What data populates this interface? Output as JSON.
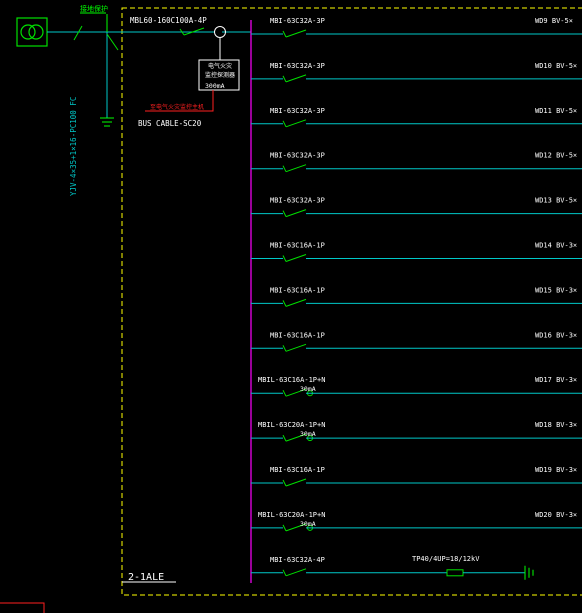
{
  "colors": {
    "background": "#000000",
    "bus": "#ff00ff",
    "feeder": "#00c8c8",
    "breaker": "#00e000",
    "enclosure": "#ffff00",
    "label": "#ffffff",
    "fire_monitor": "#ff2020",
    "grounding": "#00ff00"
  },
  "incoming": {
    "transformer_icon": "transformer-icon",
    "tag_top": "接地保护",
    "cable": "YJV-4×35+1×16-PC100 FC",
    "main_breaker": "MBL60-160C100A-4P",
    "fire_monitor_box": [
      "电气火灾",
      "监控探测器",
      "300mA"
    ],
    "fire_monitor_note": "至电气火灾监控主机",
    "bus_cable": "BUS CABLE-SC20"
  },
  "panel_name": "2-1ALE",
  "circuits": [
    {
      "breaker": "MBI-63C32A-3P",
      "rcd": "",
      "feeder": "WD9 BV-5×"
    },
    {
      "breaker": "MBI-63C32A-3P",
      "rcd": "",
      "feeder": "WD10 BV-5×"
    },
    {
      "breaker": "MBI-63C32A-3P",
      "rcd": "",
      "feeder": "WD11 BV-5×"
    },
    {
      "breaker": "MBI-63C32A-3P",
      "rcd": "",
      "feeder": "WD12 BV-5×"
    },
    {
      "breaker": "MBI-63C32A-3P",
      "rcd": "",
      "feeder": "WD13 BV-5×"
    },
    {
      "breaker": "MBI-63C16A-1P",
      "rcd": "",
      "feeder": "WD14 BV-3×"
    },
    {
      "breaker": "MBI-63C16A-1P",
      "rcd": "",
      "feeder": "WD15 BV-3×"
    },
    {
      "breaker": "MBI-63C16A-1P",
      "rcd": "",
      "feeder": "WD16 BV-3×"
    },
    {
      "breaker": "MBIL-63C16A-1P+N",
      "rcd": "30mA",
      "feeder": "WD17 BV-3×"
    },
    {
      "breaker": "MBIL-63C20A-1P+N",
      "rcd": "30mA",
      "feeder": "WD18 BV-3×"
    },
    {
      "breaker": "MBI-63C16A-1P",
      "rcd": "",
      "feeder": "WD19 BV-3×"
    },
    {
      "breaker": "MBIL-63C20A-1P+N",
      "rcd": "30mA",
      "feeder": "WD20 BV-3×"
    },
    {
      "breaker": "MBI-63C32A-4P",
      "rcd": "",
      "feeder": ""
    }
  ],
  "surge_protector": "TP40/4UP=18/12kV"
}
